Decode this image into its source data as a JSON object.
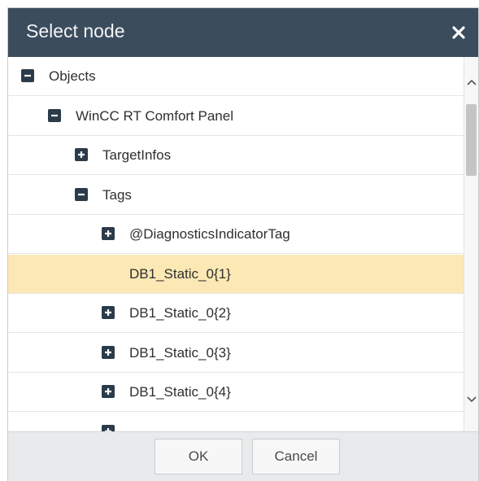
{
  "dialog": {
    "title": "Select node"
  },
  "tree": {
    "items": [
      {
        "label": "Objects",
        "toggle": "minus",
        "level": 0,
        "selected": false
      },
      {
        "label": "WinCC RT Comfort Panel",
        "toggle": "minus",
        "level": 1,
        "selected": false
      },
      {
        "label": "TargetInfos",
        "toggle": "plus",
        "level": 2,
        "selected": false
      },
      {
        "label": "Tags",
        "toggle": "minus",
        "level": 2,
        "selected": false
      },
      {
        "label": "@DiagnosticsIndicatorTag",
        "toggle": "plus",
        "level": 3,
        "selected": false
      },
      {
        "label": "DB1_Static_0{1}",
        "toggle": "none",
        "level": 3,
        "selected": true
      },
      {
        "label": "DB1_Static_0{2}",
        "toggle": "plus",
        "level": 3,
        "selected": false
      },
      {
        "label": "DB1_Static_0{3}",
        "toggle": "plus",
        "level": 3,
        "selected": false
      },
      {
        "label": "DB1_Static_0{4}",
        "toggle": "plus",
        "level": 3,
        "selected": false
      },
      {
        "label": "",
        "toggle": "plus",
        "level": 3,
        "selected": false
      }
    ]
  },
  "footer": {
    "ok_label": "OK",
    "cancel_label": "Cancel"
  },
  "colors": {
    "title_bar": "#3b4c5d",
    "selected_row": "#fbe8b4",
    "toggle_icon": "#2b3b49",
    "footer": "#e9eaeb"
  }
}
